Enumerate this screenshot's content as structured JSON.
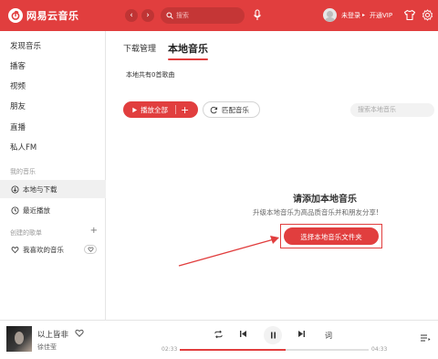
{
  "app": {
    "name": "网易云音乐",
    "brand_color": "#e13e3e"
  },
  "topbar": {
    "search_placeholder": "搜索",
    "user_status": "未登录",
    "vip_label": "开通VIP",
    "icons": [
      "back-arrow",
      "forward-arrow",
      "search",
      "microphone",
      "skin-shirt",
      "gear"
    ]
  },
  "sidebar": {
    "items": [
      {
        "label": "发现音乐"
      },
      {
        "label": "播客"
      },
      {
        "label": "视频"
      },
      {
        "label": "朋友"
      },
      {
        "label": "直播"
      },
      {
        "label": "私人FM"
      }
    ],
    "my_music_header": "我的音乐",
    "my_music": [
      {
        "label": "本地与下载",
        "icon": "download"
      },
      {
        "label": "最近播放",
        "icon": "clock"
      }
    ],
    "playlists_header": "创建的歌单",
    "playlists": [
      {
        "label": "我喜欢的音乐",
        "icon": "heart"
      }
    ]
  },
  "main": {
    "tabs": [
      {
        "label": "下载管理",
        "active": false
      },
      {
        "label": "本地音乐",
        "active": true
      }
    ],
    "count_text": "本地共有0首歌曲",
    "play_all_label": "播放全部",
    "match_label": "匹配音乐",
    "search_placeholder": "搜索本地音乐",
    "empty_title": "请添加本地音乐",
    "empty_desc": "升级本地音乐为高品质音乐并和朋友分享!",
    "choose_folder_label": "选择本地音乐文件夹"
  },
  "player": {
    "song": "以上皆非",
    "artist": "徐佳莹",
    "current_time": "02:33",
    "total_time": "04:33",
    "progress": 0.56,
    "lyric_label": "词"
  }
}
